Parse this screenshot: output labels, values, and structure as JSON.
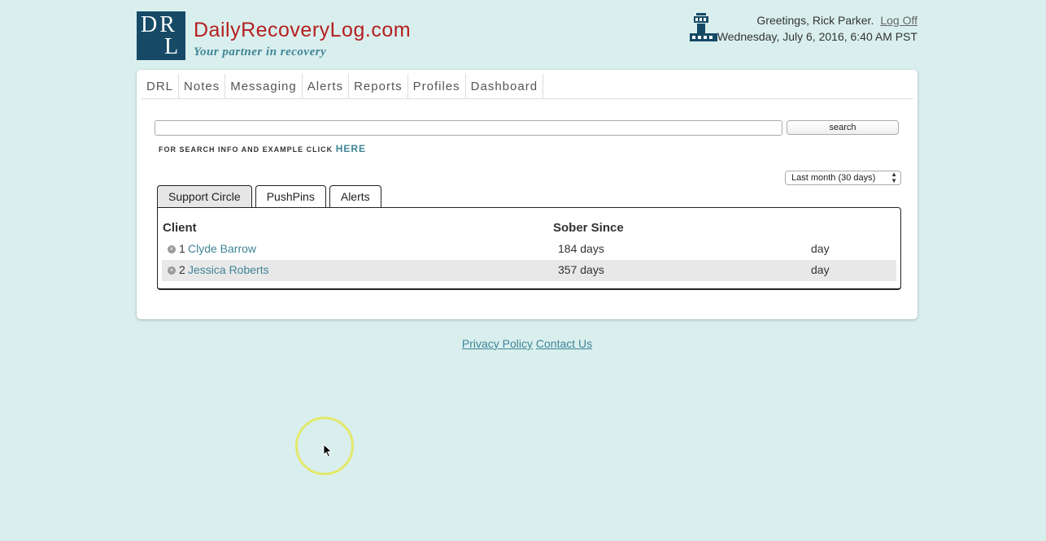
{
  "header": {
    "logo_line1": "DR",
    "logo_line2": "L",
    "brand": "DailyRecoveryLog.com",
    "tagline": "Your partner in recovery",
    "greeting": "Greetings, Rick Parker.",
    "logoff": "Log Off",
    "datetime": "Wednesday, July 6, 2016, 6:40 AM PST",
    "tower_icon": "control-tower-icon"
  },
  "nav": [
    "DRL",
    "Notes",
    "Messaging",
    "Alerts",
    "Reports",
    "Profiles",
    "Dashboard"
  ],
  "search": {
    "value": "",
    "button": "search",
    "info_prefix": "FOR SEARCH INFO AND EXAMPLE CLICK",
    "info_link": "HERE"
  },
  "range": {
    "selected": "Last month (30 days)"
  },
  "tabs": [
    "Support Circle",
    "PushPins",
    "Alerts"
  ],
  "active_tab": "Support Circle",
  "table": {
    "headers": {
      "client": "Client",
      "sober": "Sober Since"
    },
    "rows": [
      {
        "num": "1",
        "name": "Clyde Barrow",
        "days": "184 days",
        "unit": "day"
      },
      {
        "num": "2",
        "name": "Jessica Roberts",
        "days": "357 days",
        "unit": "day"
      }
    ]
  },
  "footer": {
    "privacy": "Privacy Policy",
    "contact": "Contact Us"
  },
  "colors": {
    "background": "#d9efee",
    "brand_red": "#b41f1f",
    "accent_teal": "#3f8496",
    "logo_navy": "#164a66"
  }
}
